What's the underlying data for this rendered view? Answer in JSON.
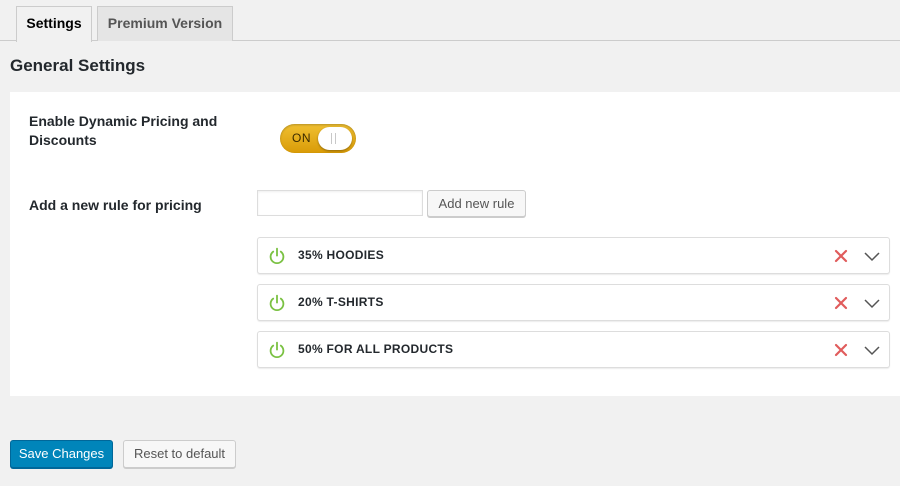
{
  "tabs": [
    {
      "label": "Settings",
      "active": true
    },
    {
      "label": "Premium Version",
      "active": false
    }
  ],
  "section_title": "General Settings",
  "settings": {
    "enable_label": "Enable Dynamic Pricing and Discounts",
    "toggle_state": "ON",
    "add_rule_label": "Add a new rule for pricing",
    "rule_input_value": "",
    "add_rule_button": "Add new rule"
  },
  "rules": [
    {
      "title": "35% HOODIES"
    },
    {
      "title": "20% T-SHIRTS"
    },
    {
      "title": "50% FOR ALL PRODUCTS"
    }
  ],
  "icons": {
    "power": "power-icon",
    "delete": "close-icon",
    "expand": "chevron-down-icon"
  },
  "colors": {
    "accent": "#0085ba",
    "toggle": "#e6a814",
    "power_active": "#7ac142",
    "delete": "#e05c5c"
  },
  "footer": {
    "save_button": "Save Changes",
    "reset_button": "Reset to default"
  }
}
